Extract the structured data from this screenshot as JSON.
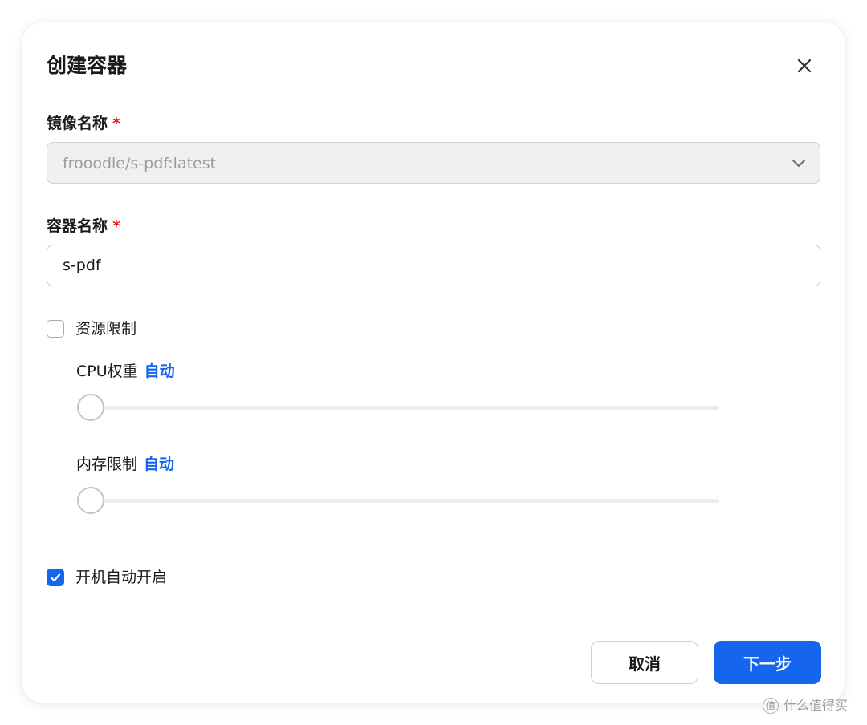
{
  "dialog": {
    "title": "创建容器",
    "close_icon": "close-icon"
  },
  "image_field": {
    "label": "镜像名称",
    "required_mark": "*",
    "value": "frooodle/s-pdf:latest",
    "icon": "chevron-down-icon",
    "disabled": true
  },
  "name_field": {
    "label": "容器名称",
    "required_mark": "*",
    "value": "s-pdf"
  },
  "resource_limit": {
    "label": "资源限制",
    "checked": false,
    "cpu": {
      "label": "CPU权重",
      "mode": "自动",
      "level": 0
    },
    "memory": {
      "label": "内存限制",
      "mode": "自动",
      "level": 0
    }
  },
  "autostart": {
    "label": "开机自动开启",
    "checked": true,
    "icon": "checkmark-icon"
  },
  "buttons": {
    "cancel": "取消",
    "next": "下一步"
  },
  "watermark": {
    "badge": "值",
    "text": "什么值得买"
  },
  "colors": {
    "accent": "#1565ee",
    "required": "#e02020",
    "disabled_bg": "#f0f0f2"
  }
}
